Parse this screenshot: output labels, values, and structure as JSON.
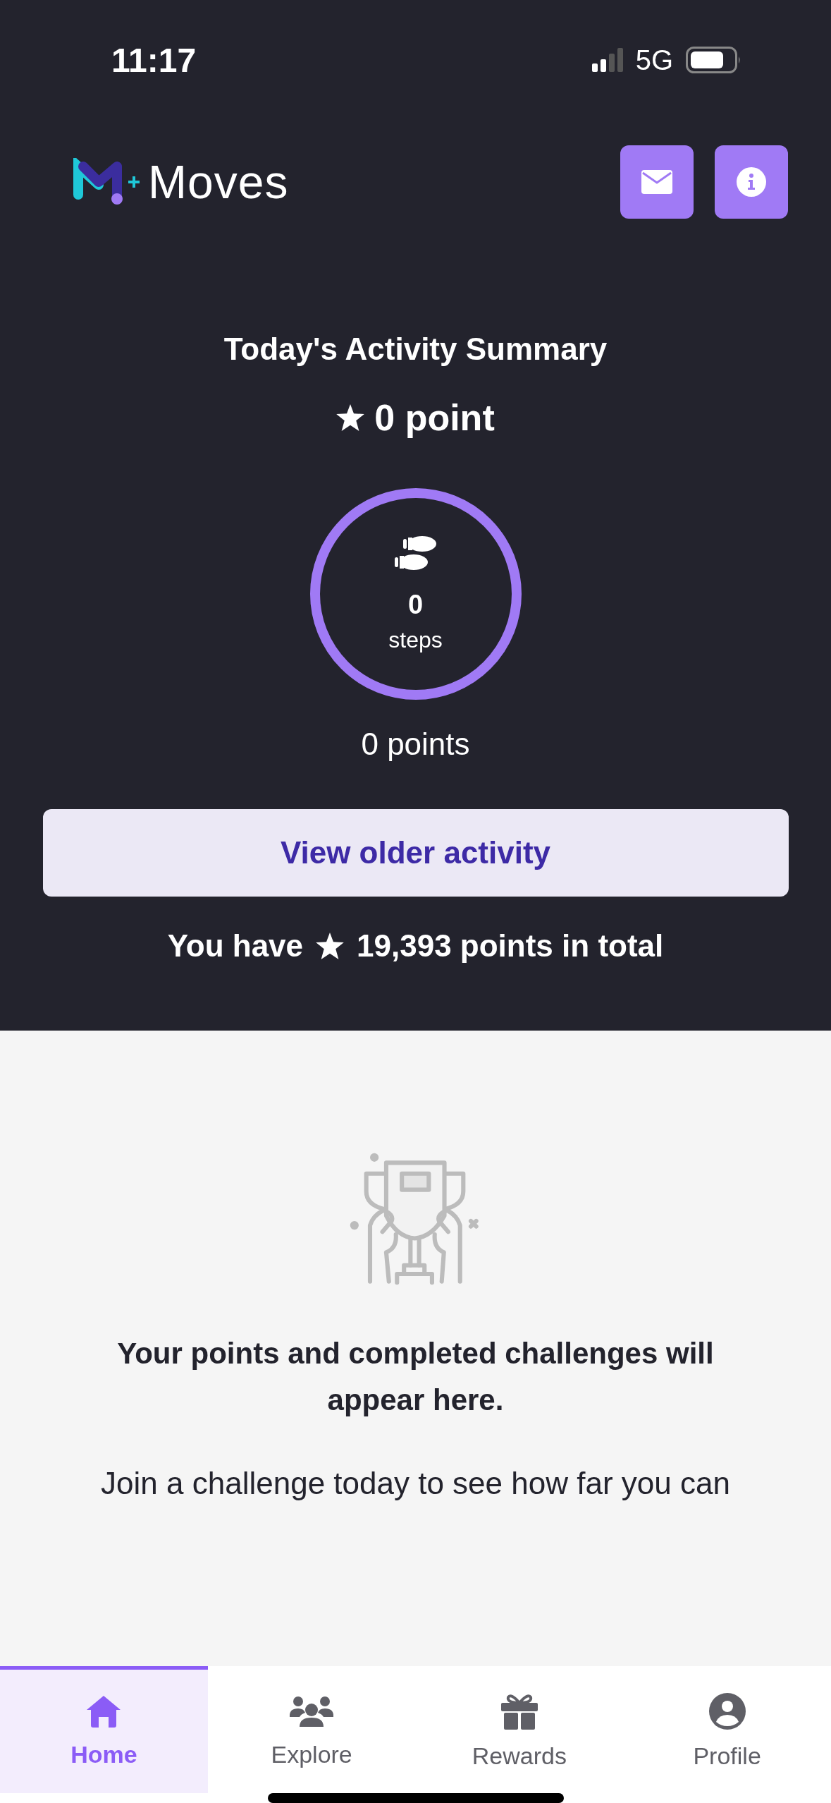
{
  "status_bar": {
    "time": "11:17",
    "network": "5G"
  },
  "header": {
    "logo_text": "Moves"
  },
  "summary": {
    "title": "Today's Activity Summary",
    "points_today": "0 point",
    "steps_value": "0",
    "steps_label": "steps",
    "points_label": "0 points",
    "button": "View older activity",
    "total_prefix": "You have",
    "total_value": "19,393 points in total"
  },
  "empty_state": {
    "heading": "Your points and completed challenges will appear here.",
    "body": "Join a challenge today to see how far you can"
  },
  "nav": [
    {
      "kind": "home",
      "label": "Home",
      "selected": true
    },
    {
      "kind": "explore",
      "label": "Explore",
      "selected": false
    },
    {
      "kind": "rewards",
      "label": "Rewards",
      "selected": false
    },
    {
      "kind": "profile",
      "label": "Profile",
      "selected": false
    }
  ]
}
